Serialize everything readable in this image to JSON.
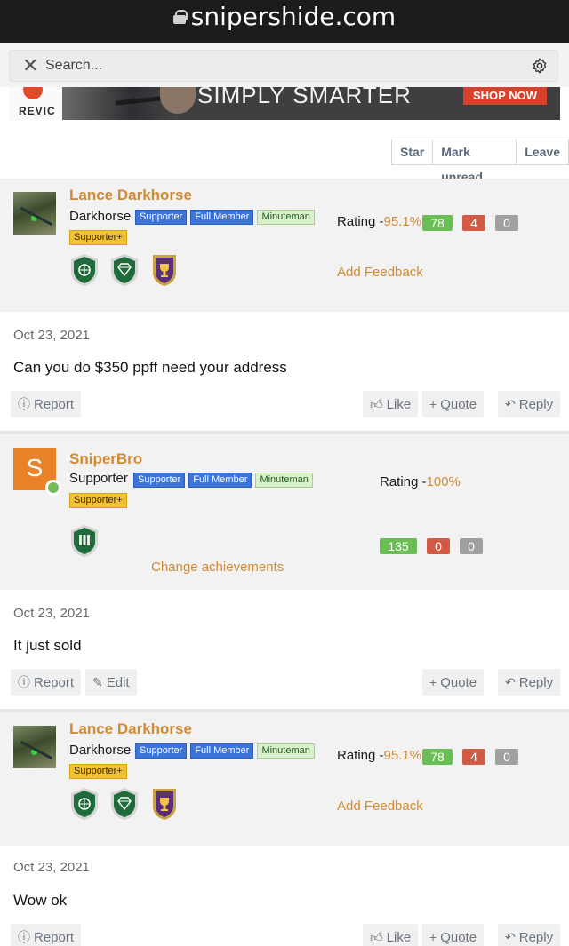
{
  "browser": {
    "url": "snipershide.com"
  },
  "search": {
    "placeholder": "Search..."
  },
  "banner": {
    "brand": "REVIC",
    "headline": "SIMPLY SMARTER",
    "cta": "SHOP NOW"
  },
  "thread_tools": {
    "star": "Star",
    "mark_unread": "Mark unread",
    "leave": "Leave"
  },
  "posts": [
    {
      "username": "Lance Darkhorse",
      "user_title": "Darkhorse",
      "badges": [
        "Supporter",
        "Full Member",
        "Minuteman"
      ],
      "badge_extra": "Supporter+",
      "rating_label": "Rating -",
      "rating_pct": "95.1%",
      "counts": [
        "78",
        "4",
        "0"
      ],
      "link": "Add Feedback",
      "date": "Oct 23, 2021",
      "text": "Can you do $350 ppff need your address",
      "actions": {
        "report": "Report",
        "like": "Like",
        "quote": "Quote",
        "reply": "Reply"
      }
    },
    {
      "username": "SniperBro",
      "avatar_letter": "S",
      "user_title": "Supporter",
      "badges": [
        "Supporter",
        "Full Member",
        "Minuteman"
      ],
      "badge_extra": "Supporter+",
      "rating_label": "Rating -",
      "rating_pct": "100%",
      "counts": [
        "135",
        "0",
        "0"
      ],
      "link": "Change achievements",
      "date": "Oct 23, 2021",
      "text": "It just sold",
      "actions": {
        "report": "Report",
        "edit": "Edit",
        "quote": "Quote",
        "reply": "Reply"
      }
    },
    {
      "username": "Lance Darkhorse",
      "user_title": "Darkhorse",
      "badges": [
        "Supporter",
        "Full Member",
        "Minuteman"
      ],
      "badge_extra": "Supporter+",
      "rating_label": "Rating -",
      "rating_pct": "95.1%",
      "counts": [
        "78",
        "4",
        "0"
      ],
      "link": "Add Feedback",
      "date": "Oct 23, 2021",
      "text": "Wow ok",
      "actions": {
        "report": "Report",
        "like": "Like",
        "quote": "Quote",
        "reply": "Reply"
      }
    }
  ]
}
